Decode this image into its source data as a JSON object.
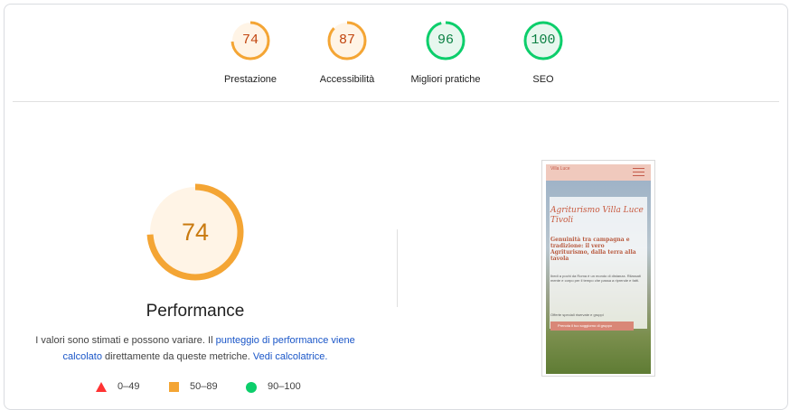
{
  "categories": [
    {
      "label": "Prestazione",
      "score": "74",
      "value": 0.74,
      "status": "average"
    },
    {
      "label": "Accessibilità",
      "score": "87",
      "value": 0.87,
      "status": "average"
    },
    {
      "label": "Migliori pratiche",
      "score": "96",
      "value": 0.96,
      "status": "pass"
    },
    {
      "label": "SEO",
      "score": "100",
      "value": 1.0,
      "status": "pass"
    }
  ],
  "colors": {
    "average_ring": "#f4a534",
    "average_fill": "#fff4e6",
    "average_text": "#c1440e",
    "pass_ring": "#0cce6b",
    "pass_fill": "#e7f7ee",
    "pass_text": "#0b8043",
    "fail": "#ff3333",
    "link": "#1a56c8"
  },
  "performance": {
    "score": "74",
    "value": 0.74,
    "title": "Performance",
    "desc_1": "I valori sono stimati e possono variare. Il ",
    "desc_link_1": "punteggio di performance viene calcolato",
    "desc_2": " direttamente da queste metriche. ",
    "desc_link_2": "Vedi calcolatrice."
  },
  "legend": [
    {
      "icon": "triangle-icon",
      "label": "0–49"
    },
    {
      "icon": "square-icon",
      "label": "50–89"
    },
    {
      "icon": "circle-icon",
      "label": "90–100"
    }
  ],
  "thumbnail": {
    "logo": "Villa Luce",
    "heading": "Agriturismo Villa Luce Tivoli",
    "subheading": "Genuinità tra campagna e tradizione: il vero Agriturismo, dalla terra alla tavola",
    "body": "Ibedi a pochi da Roma è un mondo di distanza. Rilassati mente e corpo per il tempo che passa a riprende e fatti.",
    "offer": "Offerte speciali riservate e gruppi",
    "button": "Prenota il tuo soggiorno di gruppo"
  }
}
